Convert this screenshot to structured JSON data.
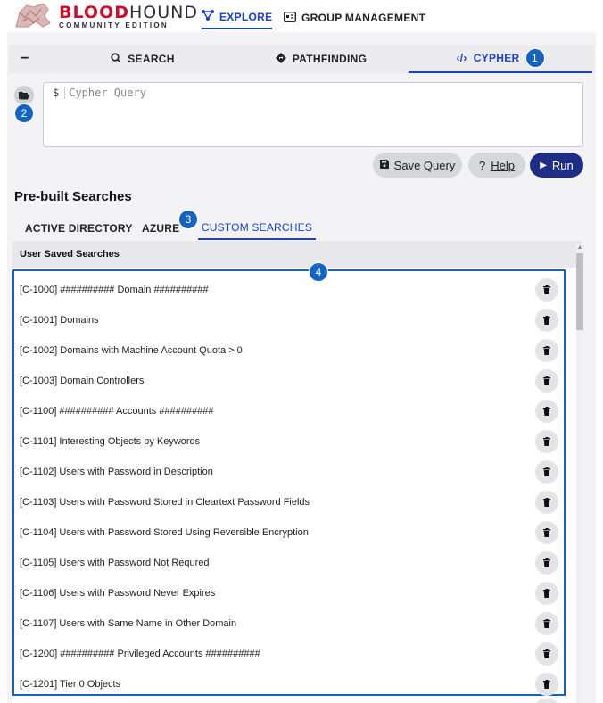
{
  "app": {
    "logo_word_red": "BLOOD",
    "logo_word_dark": "HOUND",
    "logo_subtitle": "COMMUNITY EDITION"
  },
  "nav": {
    "explore_label": "EXPLORE",
    "group_label": "GROUP MANAGEMENT"
  },
  "tabs": {
    "collapse_label": "−",
    "search_label": "SEARCH",
    "pathfinding_label": "PATHFINDING",
    "cypher_label": "CYPHER"
  },
  "query": {
    "prompt": "$",
    "placeholder": "Cypher Query"
  },
  "buttons": {
    "save_label": "Save Query",
    "help_prefix": "?",
    "help_label": "Help",
    "run_label": "Run"
  },
  "section_title": "Pre-built Searches",
  "subtabs": {
    "ad_label": "ACTIVE DIRECTORY",
    "azure_label": "AZURE",
    "custom_label": "CUSTOM SEARCHES"
  },
  "list_header": "User Saved Searches",
  "annotations": {
    "one": "1",
    "two": "2",
    "three": "3",
    "four": "4"
  },
  "saved_searches": [
    "[C-1000] ########## Domain ##########",
    "[C-1001] Domains",
    "[C-1002] Domains with Machine Account Quota > 0",
    "[C-1003] Domain Controllers",
    "[C-1100] ########## Accounts ##########",
    "[C-1101] Interesting Objects by Keywords",
    "[C-1102] Users with Password in Description",
    "[C-1103] Users with Password Stored in Cleartext Password Fields",
    "[C-1104] Users with Password Stored Using Reversible Encryption",
    "[C-1105] Users with Password Not Requred",
    "[C-1106] Users with Password Never Expires",
    "[C-1107] Users with Same Name in Other Domain",
    "[C-1200] ########## Privileged Accounts ##########",
    "[C-1201] Tier 0 Objects"
  ],
  "icons": {
    "accent": "#1a3fd1",
    "badge": "#1565c0",
    "run_bg": "#1e2e87",
    "logo_red": "#c8102e"
  }
}
